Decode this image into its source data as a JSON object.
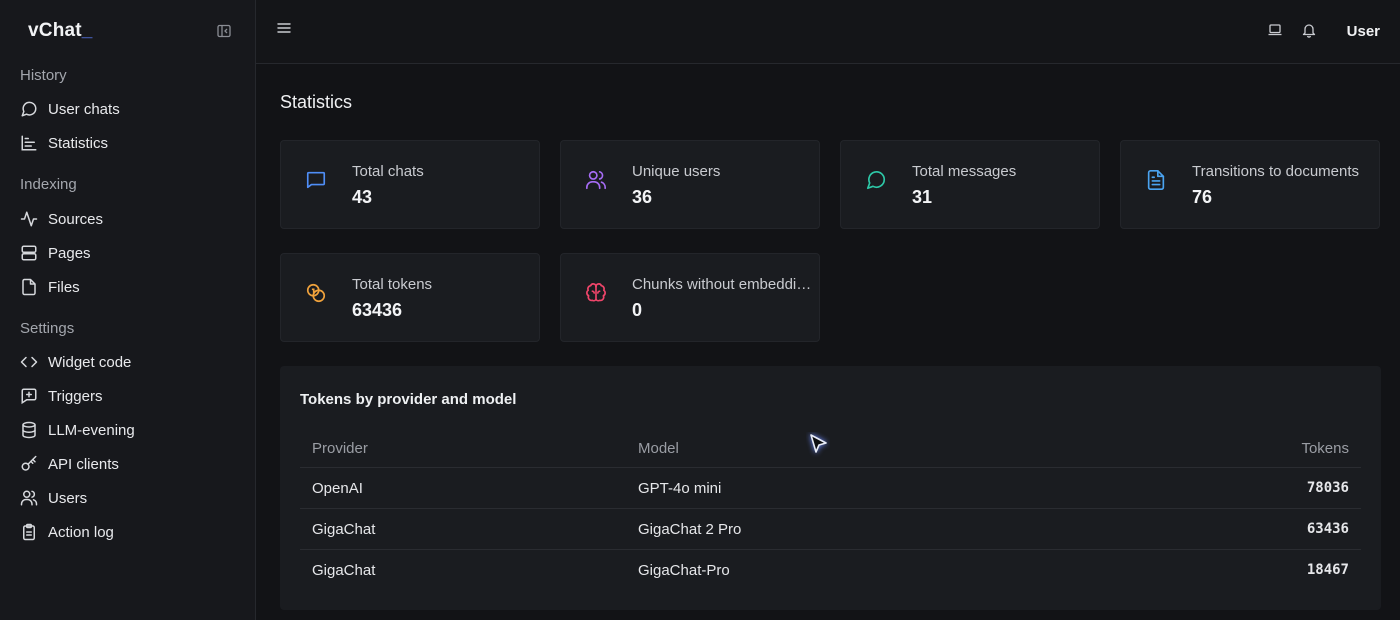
{
  "app": {
    "logo": "vChat",
    "logo_suffix": "_"
  },
  "sidebar": {
    "sections": [
      {
        "title": "History",
        "items": [
          {
            "label": "User chats",
            "icon": "chat-bubble-icon"
          },
          {
            "label": "Statistics",
            "icon": "chart-icon"
          }
        ]
      },
      {
        "title": "Indexing",
        "items": [
          {
            "label": "Sources",
            "icon": "activity-icon"
          },
          {
            "label": "Pages",
            "icon": "rows-icon"
          },
          {
            "label": "Files",
            "icon": "file-icon"
          }
        ]
      },
      {
        "title": "Settings",
        "items": [
          {
            "label": "Widget code",
            "icon": "code-icon"
          },
          {
            "label": "Triggers",
            "icon": "trigger-icon"
          },
          {
            "label": "LLM-evening",
            "icon": "database-icon"
          },
          {
            "label": "API clients",
            "icon": "key-icon"
          },
          {
            "label": "Users",
            "icon": "users-icon"
          },
          {
            "label": "Action log",
            "icon": "clipboard-icon"
          }
        ]
      }
    ]
  },
  "topbar": {
    "user_label": "User"
  },
  "page": {
    "title": "Statistics"
  },
  "stats": [
    {
      "label": "Total chats",
      "value": "43",
      "icon": "chat-square-icon",
      "color": "#4f8ef7"
    },
    {
      "label": "Unique users",
      "value": "36",
      "icon": "users-icon",
      "color": "#a66cf5"
    },
    {
      "label": "Total messages",
      "value": "31",
      "icon": "chat-bubble-icon",
      "color": "#2dc9a8"
    },
    {
      "label": "Transitions to documents",
      "value": "76",
      "icon": "document-icon",
      "color": "#4aa3f0"
    },
    {
      "label": "Total tokens",
      "value": "63436",
      "icon": "coins-icon",
      "color": "#f0a23c"
    },
    {
      "label": "Chunks without embeddings",
      "value": "0",
      "icon": "brain-icon",
      "color": "#f0456a"
    }
  ],
  "tokens_table": {
    "title": "Tokens by provider and model",
    "headers": {
      "provider": "Provider",
      "model": "Model",
      "tokens": "Tokens"
    },
    "rows": [
      {
        "provider": "OpenAI",
        "model": "GPT-4o mini",
        "tokens": "78036"
      },
      {
        "provider": "GigaChat",
        "model": "GigaChat 2 Pro",
        "tokens": "63436"
      },
      {
        "provider": "GigaChat",
        "model": "GigaChat-Pro",
        "tokens": "18467"
      }
    ]
  }
}
